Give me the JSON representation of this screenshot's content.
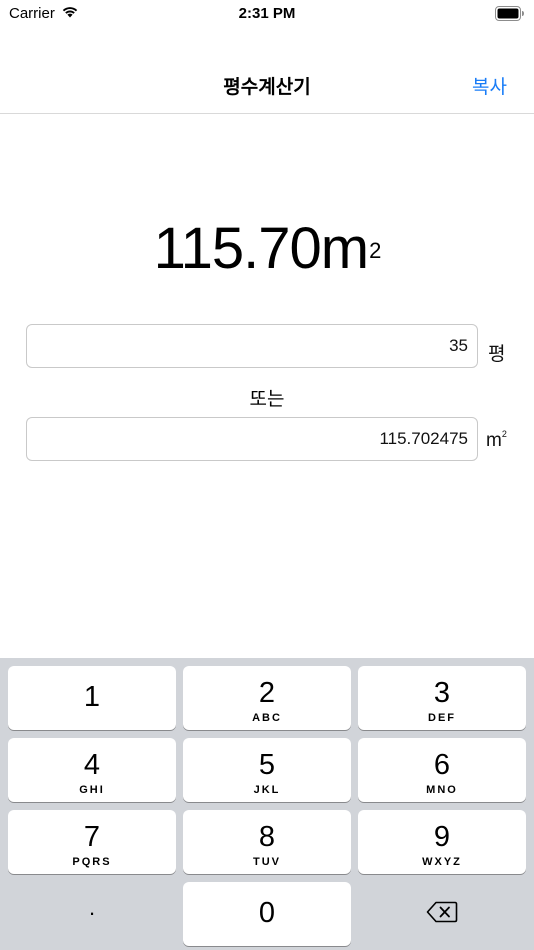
{
  "status_bar": {
    "carrier": "Carrier",
    "time": "2:31 PM",
    "icons": [
      "wifi-icon",
      "battery-icon"
    ]
  },
  "nav": {
    "title": "평수계산기",
    "copy_label": "복사",
    "accent_color": "#1a7df7"
  },
  "result": {
    "value": "115.70m",
    "superscript": "2"
  },
  "inputs": {
    "pyeong_value": "35",
    "pyeong_unit": "평",
    "or_label": "또는",
    "m2_value": "115.702475",
    "m2_unit": "m",
    "m2_unit_superscript": "2"
  },
  "keyboard": {
    "keys": [
      {
        "digit": "1",
        "letters": ""
      },
      {
        "digit": "2",
        "letters": "ABC"
      },
      {
        "digit": "3",
        "letters": "DEF"
      },
      {
        "digit": "4",
        "letters": "GHI"
      },
      {
        "digit": "5",
        "letters": "JKL"
      },
      {
        "digit": "6",
        "letters": "MNO"
      },
      {
        "digit": "7",
        "letters": "PQRS"
      },
      {
        "digit": "8",
        "letters": "TUV"
      },
      {
        "digit": "9",
        "letters": "WXYZ"
      },
      {
        "digit": "0",
        "letters": ""
      }
    ],
    "dot_label": ".",
    "delete_icon": "backspace-icon"
  }
}
